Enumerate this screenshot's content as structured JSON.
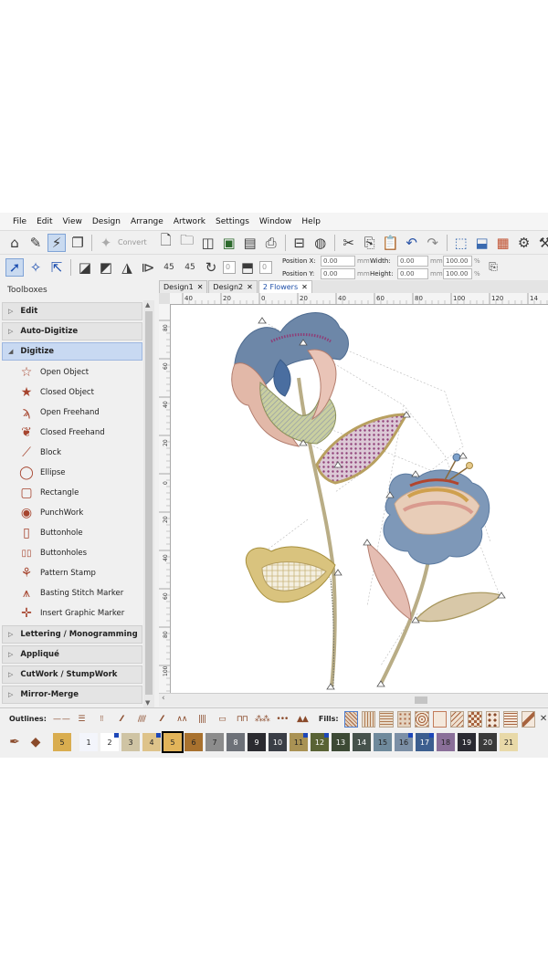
{
  "menu": [
    "File",
    "Edit",
    "View",
    "Design",
    "Arrange",
    "Artwork",
    "Settings",
    "Window",
    "Help"
  ],
  "toolbar1": {
    "convert_label": "Convert",
    "icons": [
      "home-icon",
      "edit-artwork-icon",
      "auto-digitize-icon",
      "copy-frame-icon",
      "convert-icon",
      "new-file-icon",
      "open-folder-icon",
      "open-camera-icon",
      "save-icon",
      "print-preview-icon",
      "preview-icon",
      "stitch-machine-icon",
      "mouse-icon",
      "cut-icon",
      "copy-icon",
      "paste-icon",
      "undo-icon",
      "redo-icon",
      "select-stitches-icon",
      "export-icon",
      "color-palette-icon",
      "settings-gear-icon",
      "tools-icon"
    ]
  },
  "toolbar2": {
    "rotate_left_value": "0",
    "rotate_right_value": "0",
    "position_x_label": "Position X:",
    "position_y_label": "Position Y:",
    "position_x": "0.00",
    "position_y": "0.00",
    "width_label": "Width:",
    "height_label": "Height:",
    "width": "0.00",
    "height": "0.00",
    "unit_mm": "mm",
    "scale_w": "100.00",
    "scale_h": "100.00",
    "unit_pct": "%",
    "rot_left_icon_text": "45",
    "rot_right_icon_text": "45"
  },
  "toolboxes": {
    "title": "Toolboxes",
    "sections_top": [
      {
        "label": "Edit",
        "state": "collapsed"
      },
      {
        "label": "Auto-Digitize",
        "state": "collapsed"
      },
      {
        "label": "Digitize",
        "state": "expanded"
      }
    ],
    "tools": [
      {
        "label": "Open Object",
        "icon": "open-star-icon"
      },
      {
        "label": "Closed Object",
        "icon": "closed-star-icon"
      },
      {
        "label": "Open Freehand",
        "icon": "open-freehand-icon"
      },
      {
        "label": "Closed Freehand",
        "icon": "closed-freehand-icon"
      },
      {
        "label": "Block",
        "icon": "block-icon"
      },
      {
        "label": "Ellipse",
        "icon": "ellipse-icon"
      },
      {
        "label": "Rectangle",
        "icon": "rectangle-icon"
      },
      {
        "label": "PunchWork",
        "icon": "punchwork-icon"
      },
      {
        "label": "Buttonhole",
        "icon": "buttonhole-icon"
      },
      {
        "label": "Buttonholes",
        "icon": "buttonholes-icon"
      },
      {
        "label": "Pattern Stamp",
        "icon": "pattern-stamp-icon"
      },
      {
        "label": "Basting Stitch Marker",
        "icon": "basting-marker-icon"
      },
      {
        "label": "Insert Graphic Marker",
        "icon": "graphic-marker-icon"
      }
    ],
    "sections_bottom": [
      {
        "label": "Lettering / Monogramming",
        "state": "collapsed"
      },
      {
        "label": "Appliqué",
        "state": "collapsed"
      },
      {
        "label": "CutWork / StumpWork",
        "state": "collapsed"
      },
      {
        "label": "Mirror-Merge",
        "state": "collapsed"
      }
    ]
  },
  "tabs": [
    {
      "label": "Design1",
      "active": false
    },
    {
      "label": "Design2",
      "active": false
    },
    {
      "label": "2 Flowers",
      "active": true
    }
  ],
  "close_glyph": "✕",
  "ruler_h_labels": [
    "40",
    "20",
    "0",
    "20",
    "40",
    "60",
    "80",
    "100",
    "120",
    "14"
  ],
  "ruler_v_labels": [
    "80",
    "60",
    "40",
    "20",
    "0",
    "20",
    "40",
    "60",
    "80",
    "100"
  ],
  "outlines_label": "Outlines:",
  "fills_label": "Fills:",
  "outline_patterns": [
    "— —",
    "☰",
    "⁝⁝",
    "⁄⁄⁄",
    "////",
    "⁄⁄⁄",
    "∧∧",
    "||||",
    "▭",
    "⊓⊓",
    "⁂⁂",
    "•••",
    "▲▲"
  ],
  "palette": {
    "tools": [
      "eyedropper-icon",
      "paint-bucket-icon"
    ],
    "current": {
      "num": "5",
      "color": "#d9ad4f"
    },
    "swatches": [
      {
        "num": "1",
        "color": "#f3f5fb",
        "mark": false,
        "selected": false
      },
      {
        "num": "2",
        "color": "#ffffff",
        "mark": true,
        "selected": false
      },
      {
        "num": "3",
        "color": "#cfc4a4",
        "mark": false,
        "selected": false
      },
      {
        "num": "4",
        "color": "#dec38a",
        "mark": true,
        "selected": false
      },
      {
        "num": "5",
        "color": "#e2b45a",
        "mark": false,
        "selected": true
      },
      {
        "num": "6",
        "color": "#a8712e",
        "mark": false,
        "selected": false
      },
      {
        "num": "7",
        "color": "#8c8c8c",
        "mark": false,
        "selected": false
      },
      {
        "num": "8",
        "color": "#6d7178",
        "mark": false,
        "selected": false
      },
      {
        "num": "9",
        "color": "#2b2b30",
        "mark": false,
        "selected": false
      },
      {
        "num": "10",
        "color": "#3a3e46",
        "mark": false,
        "selected": false
      },
      {
        "num": "11",
        "color": "#a99254",
        "mark": true,
        "selected": false
      },
      {
        "num": "12",
        "color": "#596335",
        "mark": true,
        "selected": false
      },
      {
        "num": "13",
        "color": "#3d4a35",
        "mark": false,
        "selected": false
      },
      {
        "num": "14",
        "color": "#46524c",
        "mark": false,
        "selected": false
      },
      {
        "num": "15",
        "color": "#6f8a9c",
        "mark": false,
        "selected": false
      },
      {
        "num": "16",
        "color": "#7b8fa6",
        "mark": true,
        "selected": false
      },
      {
        "num": "17",
        "color": "#3c5e8f",
        "mark": true,
        "selected": false
      },
      {
        "num": "18",
        "color": "#8a6f99",
        "mark": false,
        "selected": false
      },
      {
        "num": "19",
        "color": "#2a2a32",
        "mark": false,
        "selected": false
      },
      {
        "num": "20",
        "color": "#3a3a3a",
        "mark": false,
        "selected": false
      },
      {
        "num": "21",
        "color": "#e8d9a8",
        "mark": false,
        "selected": false
      }
    ]
  }
}
